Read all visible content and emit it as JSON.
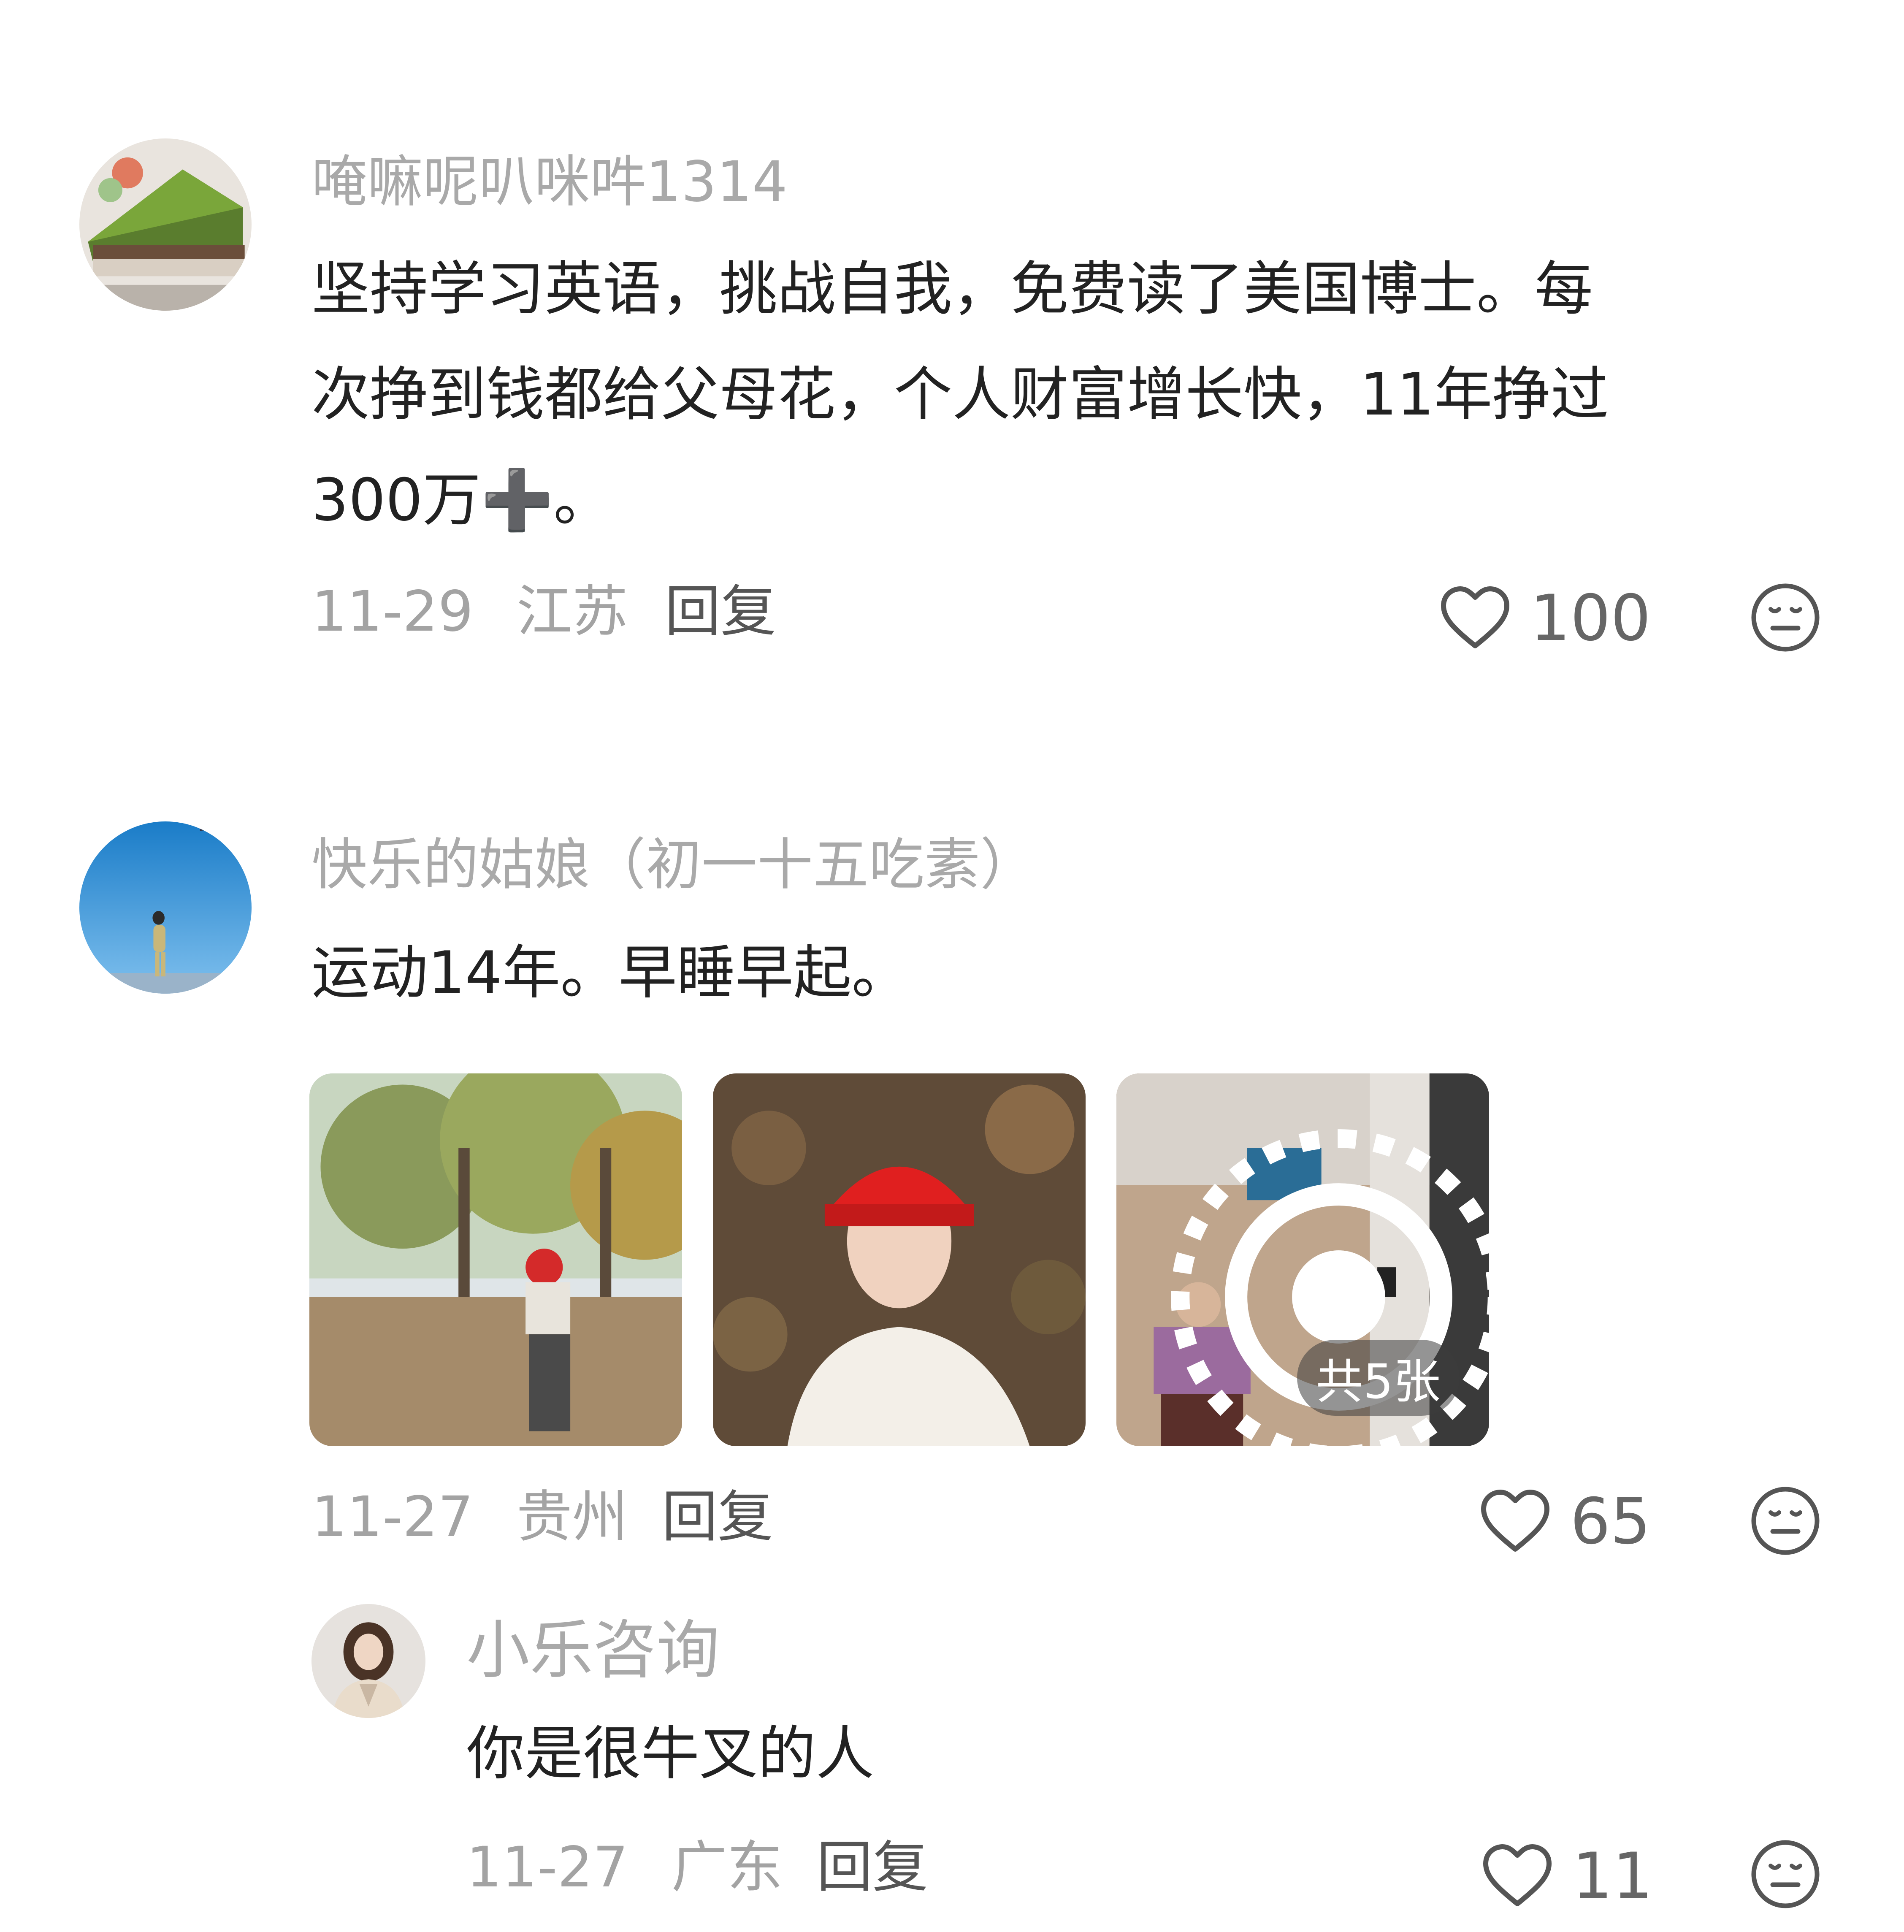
{
  "comments": [
    {
      "username": "唵嘛呢叭咪吽1314",
      "text_line1": "坚持学习英语，挑战自我，免费读了美国博士。每",
      "text_line2": "次挣到钱都给父母花，个人财富增长快，11年挣过",
      "text_line3": "300万➕。",
      "date": "11-29",
      "location": "江苏",
      "reply_label": "回复",
      "likes": "100"
    },
    {
      "username": "快乐的姑娘（初一十五吃素）",
      "text_line1": "运动14年。早睡早起。",
      "image_count_badge": "共5张",
      "date": "11-27",
      "location": "贵州",
      "reply_label": "回复",
      "likes": "65"
    },
    {
      "username": "小乐咨询",
      "text_line1": "你是很牛叉的人",
      "date": "11-27",
      "location": "广东",
      "reply_label": "回复",
      "likes": "11"
    }
  ],
  "icons": {
    "like": "heart-outline-icon",
    "dislike": "neutral-face-icon",
    "live_photo": "live-photo-icon"
  }
}
